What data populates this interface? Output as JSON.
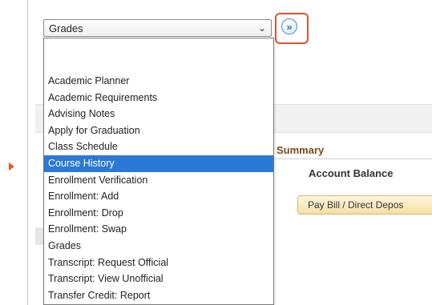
{
  "select": {
    "value": "Grades",
    "caret_icon": "chevron-down-icon"
  },
  "go_button": {
    "icon": "double-chevron-right-icon",
    "glyph": "»"
  },
  "dropdown": {
    "options": [
      "",
      "Academic Planner",
      "Academic Requirements",
      "Advising Notes",
      "Apply for Graduation",
      "Class Schedule",
      "Course History",
      "Enrollment Verification",
      "Enrollment: Add",
      "Enrollment: Drop",
      "Enrollment: Swap",
      "Grades",
      "Transcript: Request Official",
      "Transcript: View Unofficial",
      "Transfer Credit: Report"
    ],
    "highlighted_option": "Course History"
  },
  "background": {
    "summary_heading": "Summary",
    "account_balance_label": "Account Balance",
    "pay_bill_button": "Pay Bill / Direct Depos"
  },
  "colors": {
    "highlight_outline": "#e0552b",
    "selected_option_bg": "#2b79d6",
    "summary_heading": "#7a4a1a",
    "pay_bill_bg": "#f6dfa5"
  }
}
